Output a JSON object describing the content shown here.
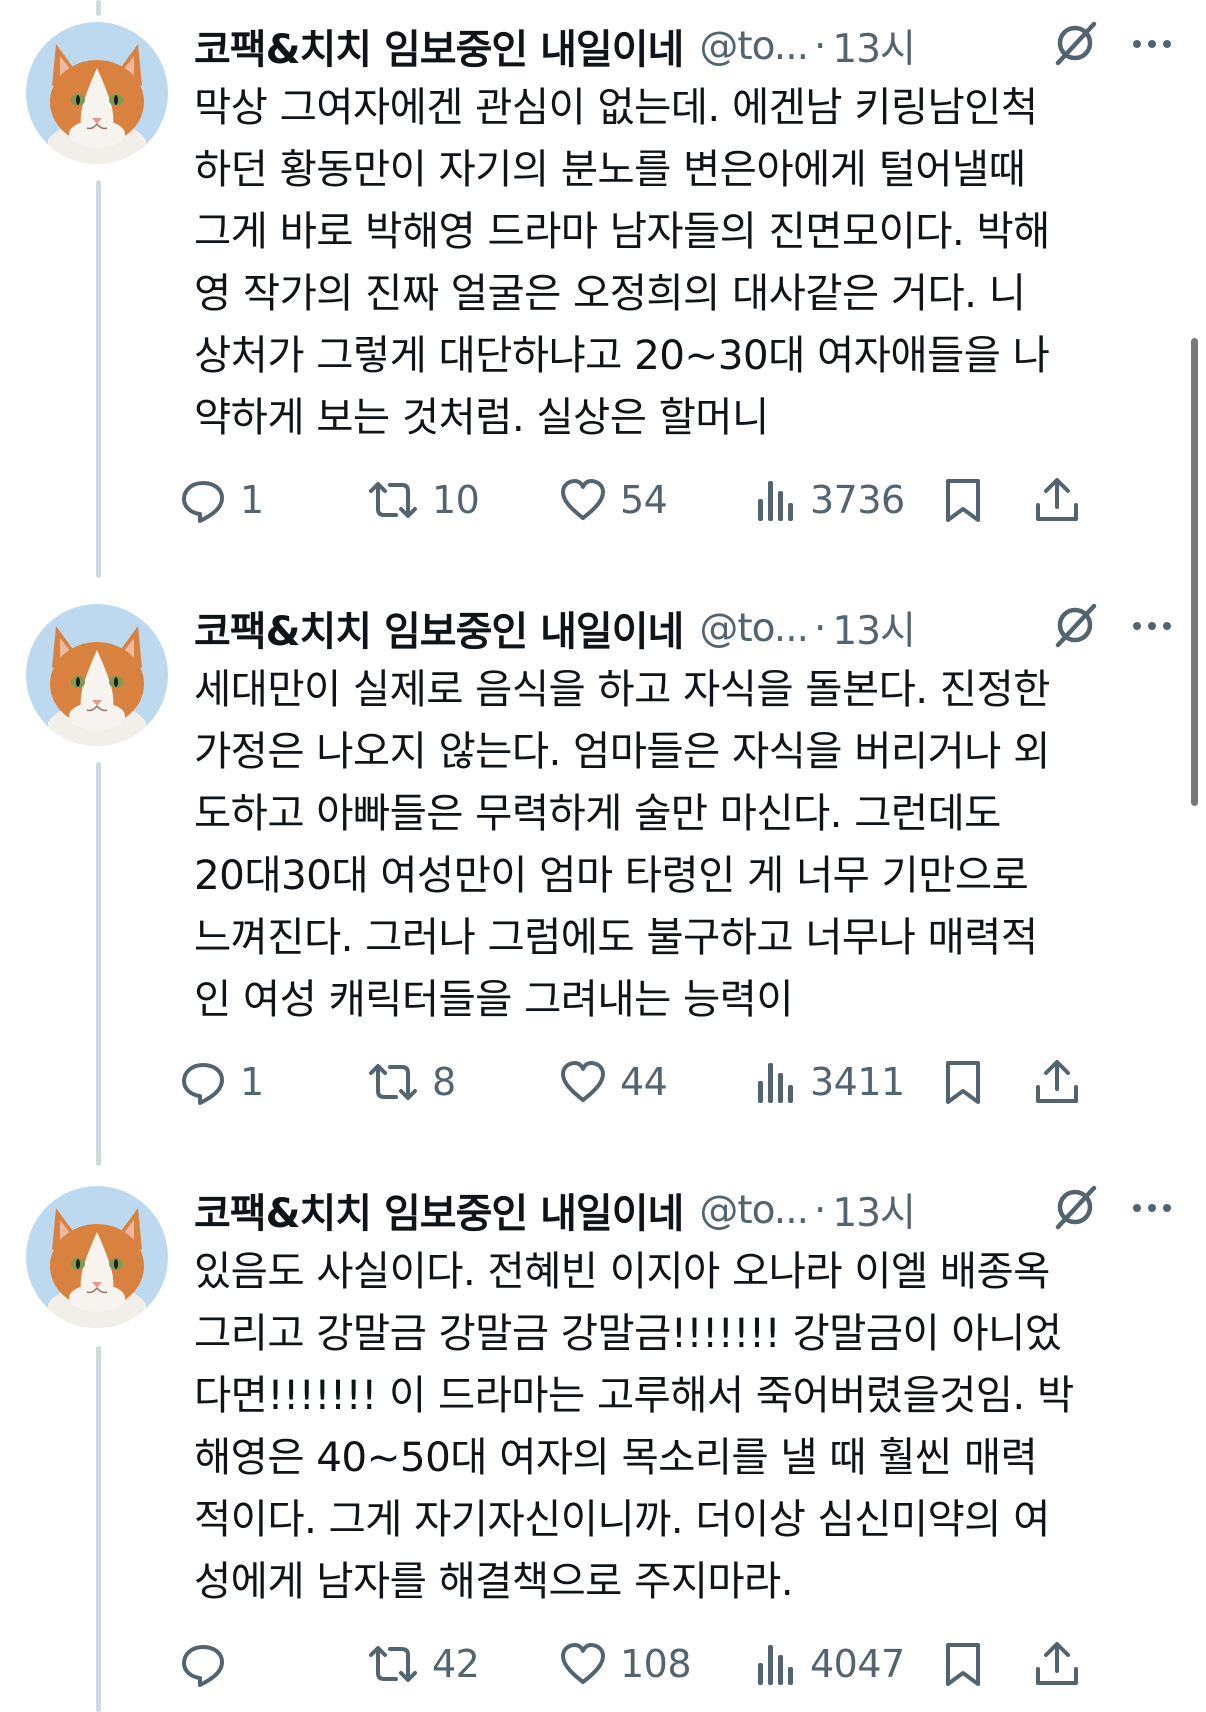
{
  "tweets": [
    {
      "display_name": "코팩&치치 임보중인 내일이네",
      "handle": "@to...",
      "time": "13시",
      "lines": [
        "막상 그여자에겐 관심이 없는데. 에겐남 키링남인척",
        "하던 황동만이 자기의 분노를 변은아에게 털어낼때",
        "그게 바로 박해영 드라마 남자들의 진면모이다. 박해",
        "영 작가의 진짜 얼굴은 오정희의 대사같은 거다. 니",
        "상처가 그렇게 대단하냐고 20~30대 여자애들을 나",
        "약하게 보는 것처럼. 실상은 할머니"
      ],
      "replies": "1",
      "reposts": "10",
      "likes": "54",
      "views": "3736"
    },
    {
      "display_name": "코팩&치치 임보중인 내일이네",
      "handle": "@to...",
      "time": "13시",
      "lines": [
        "세대만이 실제로 음식을 하고 자식을 돌본다. 진정한",
        "가정은 나오지 않는다. 엄마들은 자식을 버리거나 외",
        "도하고 아빠들은 무력하게 술만 마신다. 그런데도",
        "20대30대 여성만이 엄마 타령인 게 너무 기만으로",
        "느껴진다. 그러나 그럼에도 불구하고 너무나 매력적",
        "인 여성 캐릭터들을 그려내는 능력이"
      ],
      "replies": "1",
      "reposts": "8",
      "likes": "44",
      "views": "3411"
    },
    {
      "display_name": "코팩&치치 임보중인 내일이네",
      "handle": "@to...",
      "time": "13시",
      "lines": [
        "있음도 사실이다. 전혜빈 이지아 오나라 이엘 배종옥",
        "그리고 강말금 강말금 강말금!!!!!!! 강말금이 아니었",
        "다면!!!!!!! 이 드라마는 고루해서 죽어버렸을것임. 박",
        "해영은 40~50대 여자의 목소리를 낼 때 훨씬 매력",
        "적이다. 그게 자기자신이니까. 더이상 심신미약의 여",
        "성에게 남자를 해결책으로 주지마라."
      ],
      "replies": "",
      "reposts": "42",
      "likes": "108",
      "views": "4047"
    }
  ],
  "icons": {
    "avatar": "orange-white-cat-avatar",
    "grok": "grok-slash-circle-icon",
    "more": "more-dots-icon",
    "reply": "reply-bubble-icon",
    "repost": "repost-arrows-icon",
    "like": "heart-icon",
    "views": "views-bar-chart-icon",
    "bookmark": "bookmark-icon",
    "share": "share-upload-icon"
  },
  "colors": {
    "text": "#0f1419",
    "secondary": "#536471",
    "thread_line": "#cfd9de",
    "avatar_bg": "#bcd9f0",
    "cat_orange": "#d9823f"
  }
}
